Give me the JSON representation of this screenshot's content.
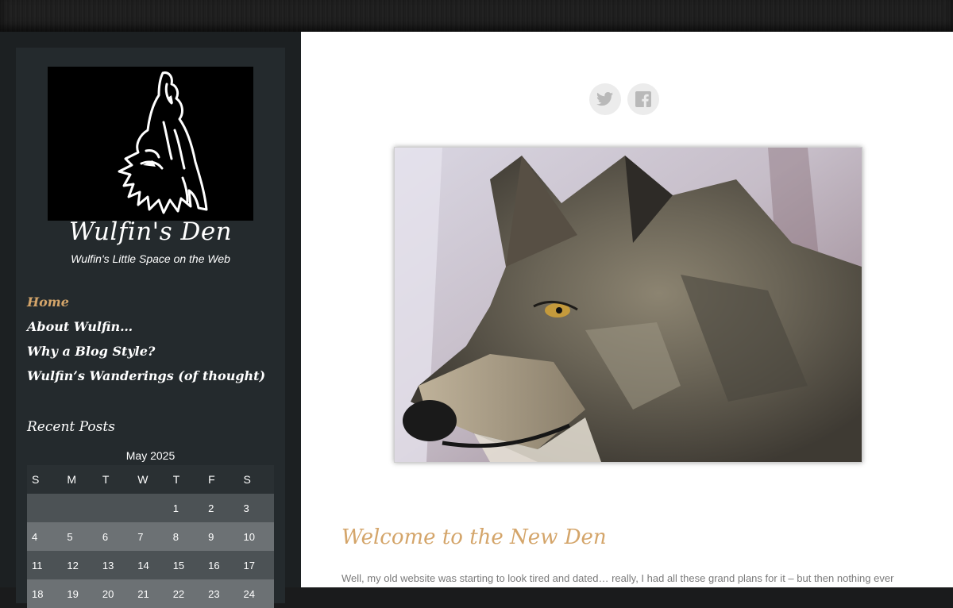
{
  "site": {
    "title": "Wulfin's Den",
    "tagline": "Wulfin's Little Space on the Web"
  },
  "nav": [
    {
      "label": "Home",
      "active": true
    },
    {
      "label": "About Wulfin…",
      "active": false
    },
    {
      "label": "Why a Blog Style?",
      "active": false
    },
    {
      "label": "Wulfin’s Wanderings (of thought)",
      "active": false
    }
  ],
  "widget": {
    "title": "Recent Posts"
  },
  "calendar": {
    "caption": "May 2025",
    "headers": [
      "S",
      "M",
      "T",
      "W",
      "T",
      "F",
      "S"
    ],
    "rows": [
      [
        "",
        "",
        "",
        "",
        "1",
        "2",
        "3"
      ],
      [
        "4",
        "5",
        "6",
        "7",
        "8",
        "9",
        "10"
      ],
      [
        "11",
        "12",
        "13",
        "14",
        "15",
        "16",
        "17"
      ],
      [
        "18",
        "19",
        "20",
        "21",
        "22",
        "23",
        "24"
      ]
    ]
  },
  "social": {
    "icons": [
      "twitter-icon",
      "facebook-icon"
    ]
  },
  "post": {
    "title": "Welcome to the New Den",
    "excerpt": "Well, my old website was starting to look tired and dated… really, I had all these grand plans for it – but then nothing ever"
  },
  "colors": {
    "accent": "#d4a56a",
    "sidebar": "#242a2d",
    "background": "#1a1b1c"
  }
}
